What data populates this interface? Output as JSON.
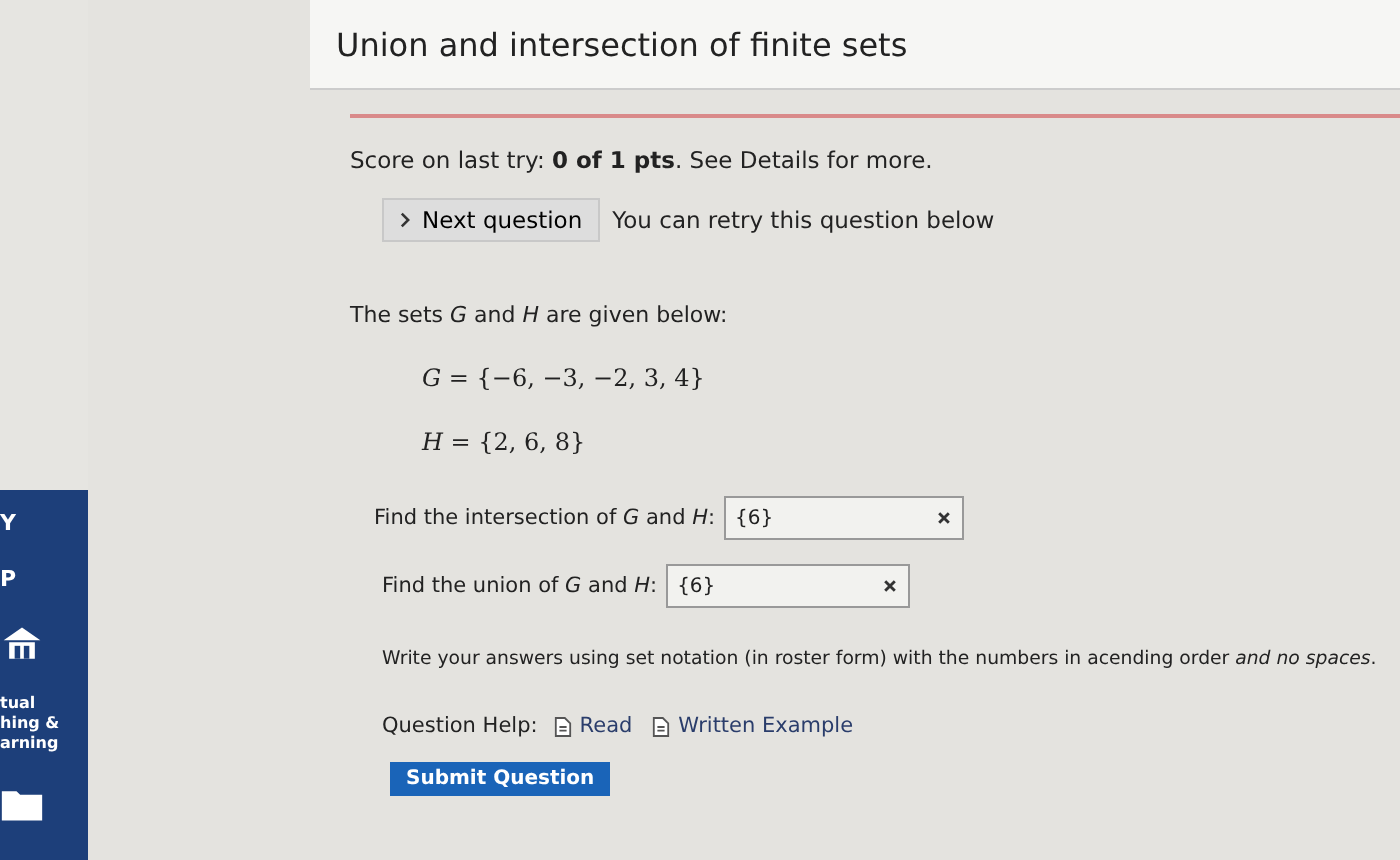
{
  "sidebar": {
    "items": [
      {
        "label": "Y",
        "kind": "text"
      },
      {
        "label": "P",
        "kind": "text"
      },
      {
        "label": "tual\nhing &\narning",
        "kind": "house"
      },
      {
        "kind": "folder"
      }
    ]
  },
  "title": "Union and intersection of finite sets",
  "score": "Score on last try: **0 of 1 pts**. See Details for more.",
  "next_button": "Next question",
  "retry_note": "You can retry this question below",
  "intro": "The sets *G* and *H* are given below:",
  "equations": [
    "*G* = {−6, −3, −2, 3, 4}",
    "*H* = {2, 6, 8}"
  ],
  "questions": [
    {
      "prompt": "Find the intersection of *G* and *H*:",
      "value": "{6}",
      "correct": false
    },
    {
      "prompt": "Find the union of *G* and *H*:",
      "value": "{6}",
      "correct": false
    }
  ],
  "instruction": "Write your answers using set notation (in roster form) with the numbers in acending order *and no spaces*.",
  "help": {
    "label": "Question Help:",
    "links": [
      "Read",
      "Written Example"
    ]
  },
  "submit_button": "Submit Question"
}
